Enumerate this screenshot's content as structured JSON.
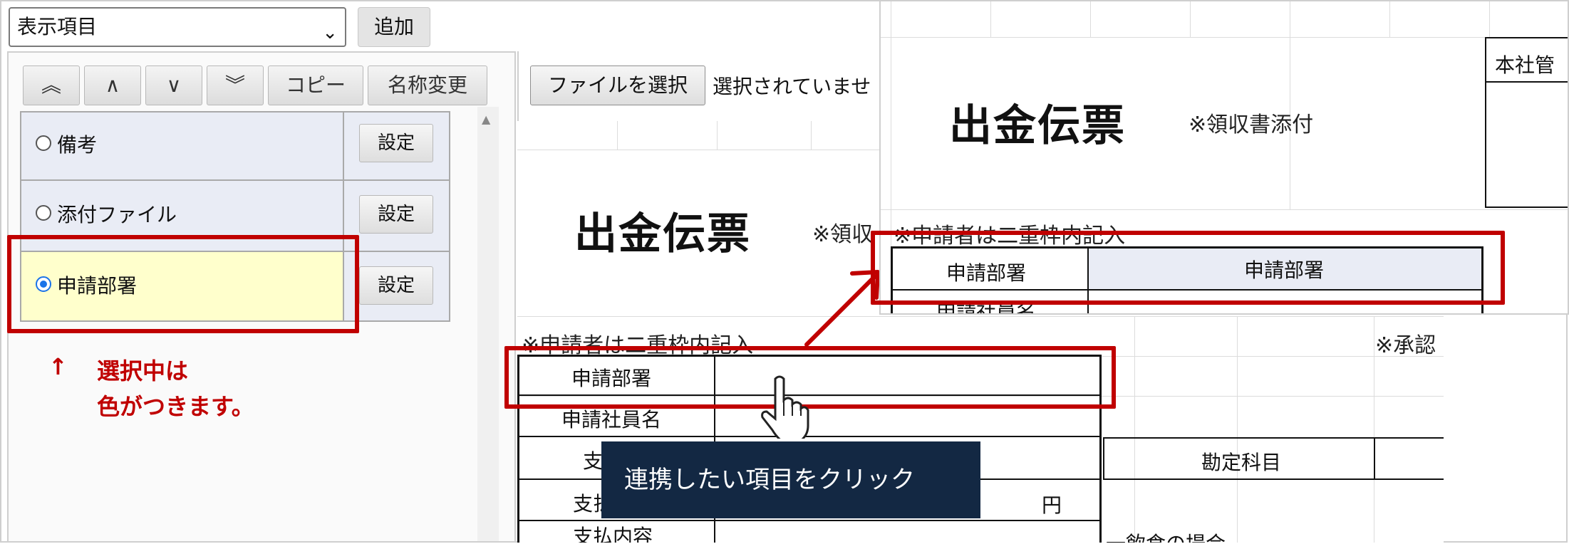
{
  "top_bar": {
    "select_value": "表示項目",
    "add_label": "追加"
  },
  "toolbar": {
    "move_top": "︽",
    "move_up": "∧",
    "move_down": "∨",
    "move_bottom": "︾",
    "copy_label": "コピー",
    "rename_label": "名称変更"
  },
  "item_list": {
    "items": [
      {
        "label": "備考",
        "setting_label": "設定",
        "selected": false
      },
      {
        "label": "添付ファイル",
        "setting_label": "設定",
        "selected": false
      },
      {
        "label": "申請部署",
        "setting_label": "設定",
        "selected": true
      }
    ]
  },
  "annotation": {
    "arrow": "↑",
    "line1": "選択中は",
    "line2": "色がつきます。"
  },
  "file": {
    "button_label": "ファイルを選択",
    "status": "選択されていませ"
  },
  "sheet": {
    "title": "出金伝票",
    "receipt_note": "※領収",
    "applicant_note": "※申請者は二重枠内記入",
    "approval_note": "※承認",
    "rows": [
      "申請部署",
      "申請社員名",
      "支",
      "支払",
      "支払内容"
    ],
    "account_label": "勘定科目",
    "yen": "円",
    "footer_note": "一飲食の場合"
  },
  "tooltip": {
    "text": "連携したい項目をクリック"
  },
  "zoom": {
    "title": "出金伝票",
    "receipt_note": "※領収書添付",
    "head_office": "本社管",
    "applicant_note": "※申請者は二重枠内記入",
    "row_label": "申請部署",
    "row_value": "申請部署",
    "next_row": "申請社員名"
  },
  "colors": {
    "highlight_red": "#c00000",
    "selected_bg": "#ffffcc",
    "tooltip_bg": "#132843"
  }
}
